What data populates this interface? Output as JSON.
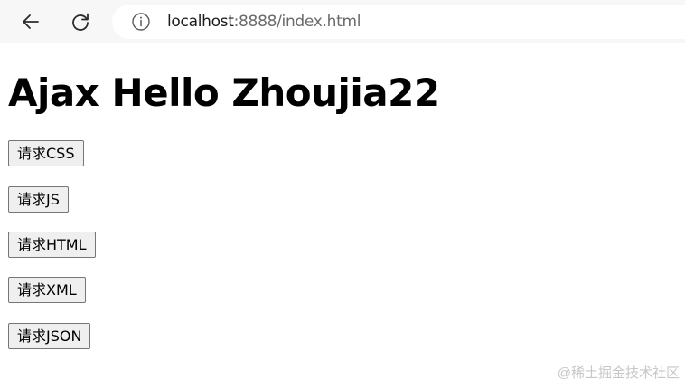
{
  "browser": {
    "url_host": "localhost",
    "url_rest": ":8888/index.html"
  },
  "page": {
    "title": "Ajax Hello Zhoujia22",
    "buttons": [
      {
        "label": "请求CSS"
      },
      {
        "label": "请求JS"
      },
      {
        "label": "请求HTML"
      },
      {
        "label": "请求XML"
      },
      {
        "label": "请求JSON"
      }
    ]
  },
  "watermark": "@稀土掘金技术社区"
}
